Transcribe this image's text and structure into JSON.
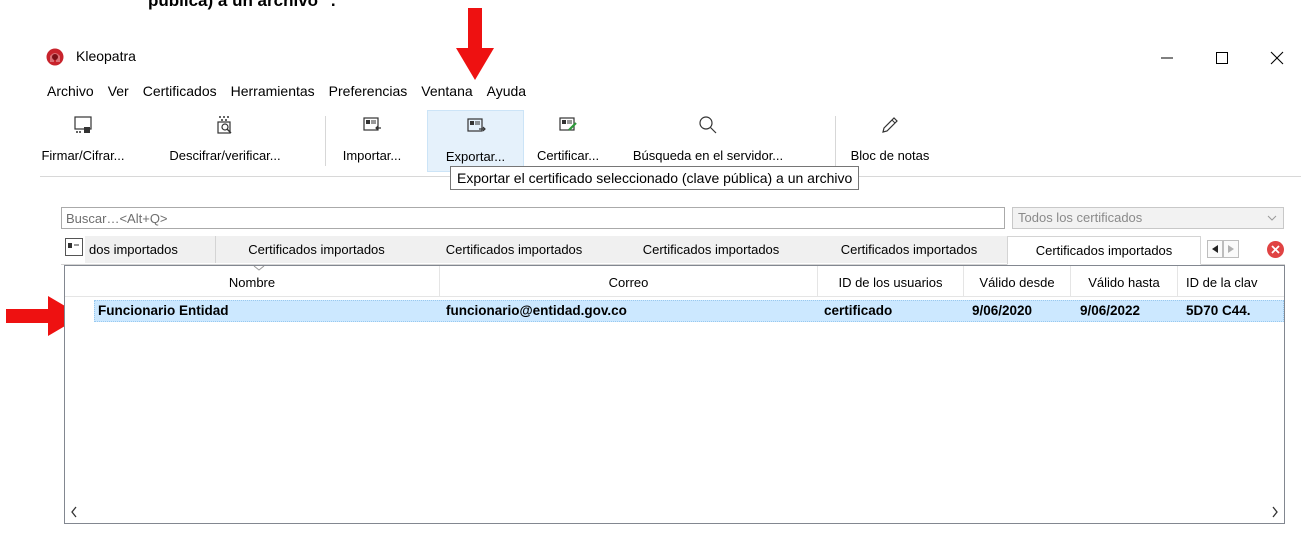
{
  "document": {
    "heading_fragment": "pública) a un archivo \"."
  },
  "window": {
    "title": "Kleopatra",
    "minimize_label": "—",
    "maximize_label": "☐",
    "close_label": "✕"
  },
  "menu": [
    "Archivo",
    "Ver",
    "Certificados",
    "Herramientas",
    "Preferencias",
    "Ventana",
    "Ayuda"
  ],
  "toolbar": {
    "firmar": "Firmar/Cifrar...",
    "descifrar": "Descifrar/verificar...",
    "importar": "Importar...",
    "exportar": "Exportar...",
    "certificar": "Certificar...",
    "busqueda": "Búsqueda en el servidor...",
    "bloc": "Bloc de notas"
  },
  "tooltip": "Exportar el certificado seleccionado (clave pública) a un archivo",
  "search": {
    "placeholder": "Buscar…<Alt+Q>"
  },
  "filter": {
    "selected": "Todos los certificados"
  },
  "tabs": [
    "dos importados",
    "Certificados importados",
    "Certificados importados",
    "Certificados importados",
    "Certificados importados",
    "Certificados importados"
  ],
  "table": {
    "columns": [
      "Nombre",
      "Correo",
      "ID de los usuarios",
      "Válido desde",
      "Válido hasta",
      "ID de la clav"
    ],
    "rows": [
      {
        "nombre": "Funcionario Entidad",
        "correo": "funcionario@entidad.gov.co",
        "id_usuarios": "certificado",
        "valido_desde": "9/06/2020",
        "valido_hasta": "9/06/2022",
        "id_clave": "5D70 C44."
      }
    ]
  },
  "colors": {
    "annotation_red": "#ee1111",
    "selection_blue": "#cce8ff",
    "tab_close_red": "#e04343"
  }
}
